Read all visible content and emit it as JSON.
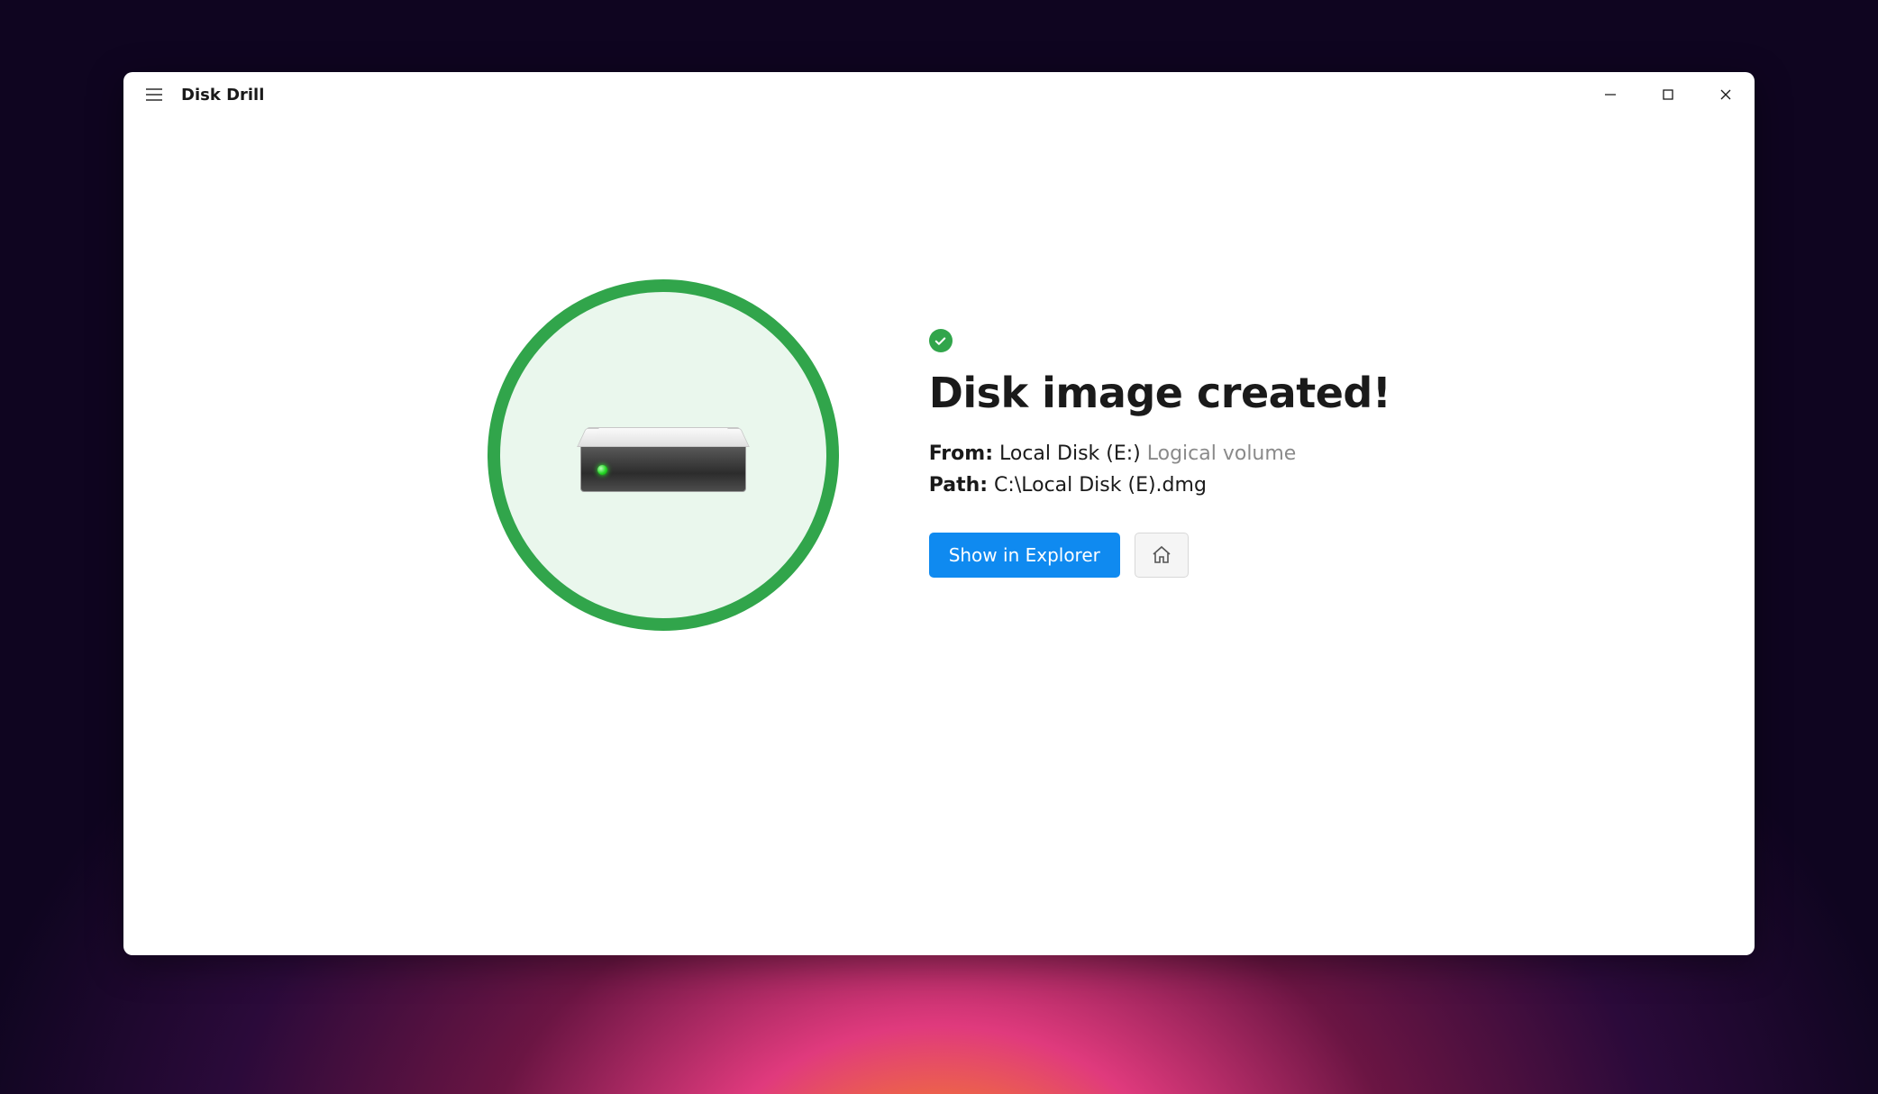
{
  "app": {
    "title": "Disk Drill"
  },
  "result": {
    "heading": "Disk image created!",
    "from_label": "From:",
    "from_value": "Local Disk (E:)",
    "from_type": "Logical volume",
    "path_label": "Path:",
    "path_value": "C:\\Local Disk (E).dmg",
    "primary_button": "Show in Explorer"
  },
  "colors": {
    "accent_green": "#31a54b",
    "primary_blue": "#0f8af0"
  }
}
